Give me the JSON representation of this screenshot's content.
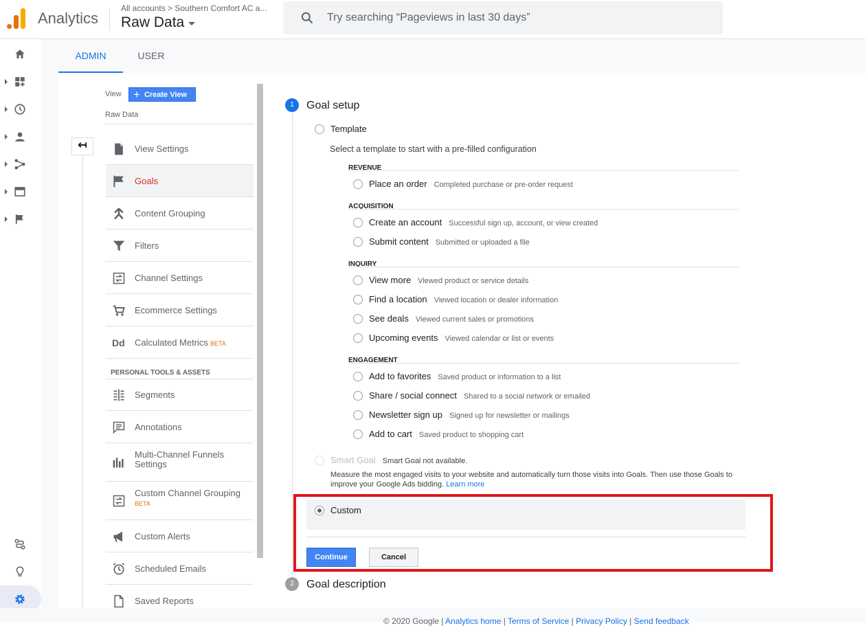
{
  "header": {
    "app_name": "Analytics",
    "breadcrumb": "All accounts > Southern Comfort AC a...",
    "view_name": "Raw Data",
    "search_placeholder": "Try searching “Pageviews in last 30 days”"
  },
  "tabs": [
    {
      "label": "ADMIN",
      "active": true
    },
    {
      "label": "USER",
      "active": false
    }
  ],
  "view_column": {
    "view_label": "View",
    "create_view_label": "Create View",
    "view_name": "Raw Data",
    "items": [
      {
        "label": "View Settings",
        "icon": "document-icon"
      },
      {
        "label": "Goals",
        "icon": "flag-icon",
        "active": true
      },
      {
        "label": "Content Grouping",
        "icon": "content-grouping-icon"
      },
      {
        "label": "Filters",
        "icon": "filter-icon"
      },
      {
        "label": "Channel Settings",
        "icon": "channel-settings-icon"
      },
      {
        "label": "Ecommerce Settings",
        "icon": "cart-icon"
      },
      {
        "label": "Calculated Metrics",
        "icon": "dd-icon",
        "badge": "BETA"
      }
    ],
    "section_label": "PERSONAL TOOLS & ASSETS",
    "tools": [
      {
        "label": "Segments",
        "icon": "segments-icon"
      },
      {
        "label": "Annotations",
        "icon": "annotations-icon"
      },
      {
        "label": "Multi-Channel Funnels Settings",
        "icon": "bar-chart-icon"
      },
      {
        "label": "Custom Channel Grouping",
        "icon": "channel-grouping-icon",
        "badge": "BETA"
      },
      {
        "label": "Custom Alerts",
        "icon": "megaphone-icon"
      },
      {
        "label": "Scheduled Emails",
        "icon": "clock-icon"
      },
      {
        "label": "Saved Reports",
        "icon": "saved-report-icon"
      }
    ]
  },
  "goal_setup": {
    "step1_number": "1",
    "step1_title": "Goal setup",
    "template_label": "Template",
    "template_desc": "Select a template to start with a pre-filled configuration",
    "categories": [
      {
        "name": "REVENUE",
        "options": [
          {
            "label": "Place an order",
            "desc": "Completed purchase or pre-order request"
          }
        ]
      },
      {
        "name": "ACQUISITION",
        "options": [
          {
            "label": "Create an account",
            "desc": "Successful sign up, account, or view created"
          },
          {
            "label": "Submit content",
            "desc": "Submitted or uploaded a file"
          }
        ]
      },
      {
        "name": "INQUIRY",
        "options": [
          {
            "label": "View more",
            "desc": "Viewed product or service details"
          },
          {
            "label": "Find a location",
            "desc": "Viewed location or dealer information"
          },
          {
            "label": "See deals",
            "desc": "Viewed current sales or promotions"
          },
          {
            "label": "Upcoming events",
            "desc": "Viewed calendar or list or events"
          }
        ]
      },
      {
        "name": "ENGAGEMENT",
        "options": [
          {
            "label": "Add to favorites",
            "desc": "Saved product or information to a list"
          },
          {
            "label": "Share / social connect",
            "desc": "Shared to a social network or emailed"
          },
          {
            "label": "Newsletter sign up",
            "desc": "Signed up for newsletter or mailings"
          },
          {
            "label": "Add to cart",
            "desc": "Saved product to shopping cart"
          }
        ]
      }
    ],
    "smart_goal_label": "Smart Goal",
    "smart_goal_status": "Smart Goal not available.",
    "smart_goal_desc1": "Measure the most engaged visits to your website and automatically turn those visits into Goals. Then use those Goals to",
    "smart_goal_desc2": "improve your Google Ads bidding.",
    "learn_more": "Learn more",
    "custom_label": "Custom",
    "continue_label": "Continue",
    "cancel_label": "Cancel",
    "step2_number": "2",
    "step2_title": "Goal description"
  },
  "footer": {
    "copyright": "© 2020 Google |",
    "links": [
      "Analytics home",
      "Terms of Service",
      "Privacy Policy",
      "Send feedback"
    ]
  },
  "colors": {
    "accent": "#1a73e8",
    "active_goal": "#d93025",
    "highlight": "#e0161b",
    "logo_orange": "#e37400",
    "logo_yellow": "#f9ab00"
  }
}
